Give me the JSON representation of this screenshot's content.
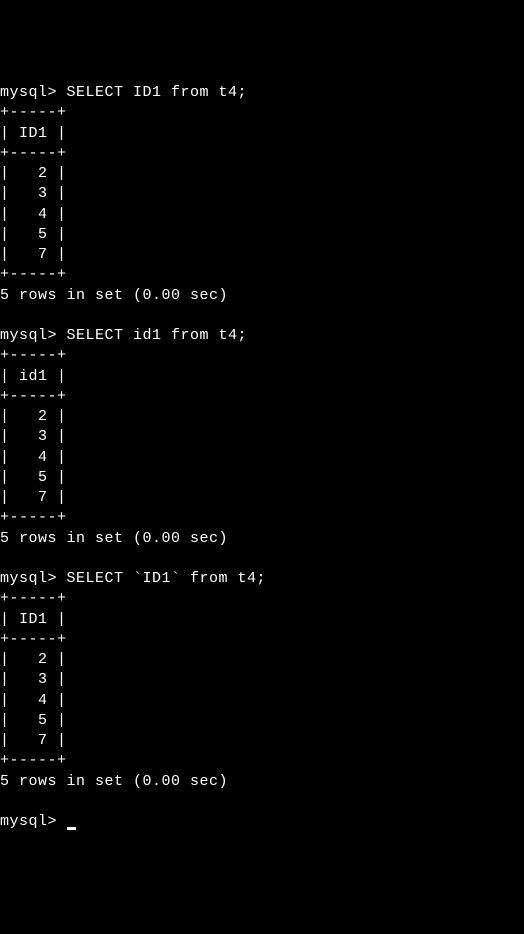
{
  "queries": [
    {
      "prompt": "mysql> ",
      "sql": "SELECT ID1 from t4;",
      "border": "+-----+",
      "header": "| ID1 |",
      "rows": [
        "|   2 |",
        "|   3 |",
        "|   4 |",
        "|   5 |",
        "|   7 |"
      ],
      "status": "5 rows in set (0.00 sec)"
    },
    {
      "prompt": "mysql> ",
      "sql": "SELECT id1 from t4;",
      "border": "+-----+",
      "header": "| id1 |",
      "rows": [
        "|   2 |",
        "|   3 |",
        "|   4 |",
        "|   5 |",
        "|   7 |"
      ],
      "status": "5 rows in set (0.00 sec)"
    },
    {
      "prompt": "mysql> ",
      "sql": "SELECT `ID1` from t4;",
      "border": "+-----+",
      "header": "| ID1 |",
      "rows": [
        "|   2 |",
        "|   3 |",
        "|   4 |",
        "|   5 |",
        "|   7 |"
      ],
      "status": "5 rows in set (0.00 sec)"
    }
  ],
  "final_prompt": "mysql> "
}
